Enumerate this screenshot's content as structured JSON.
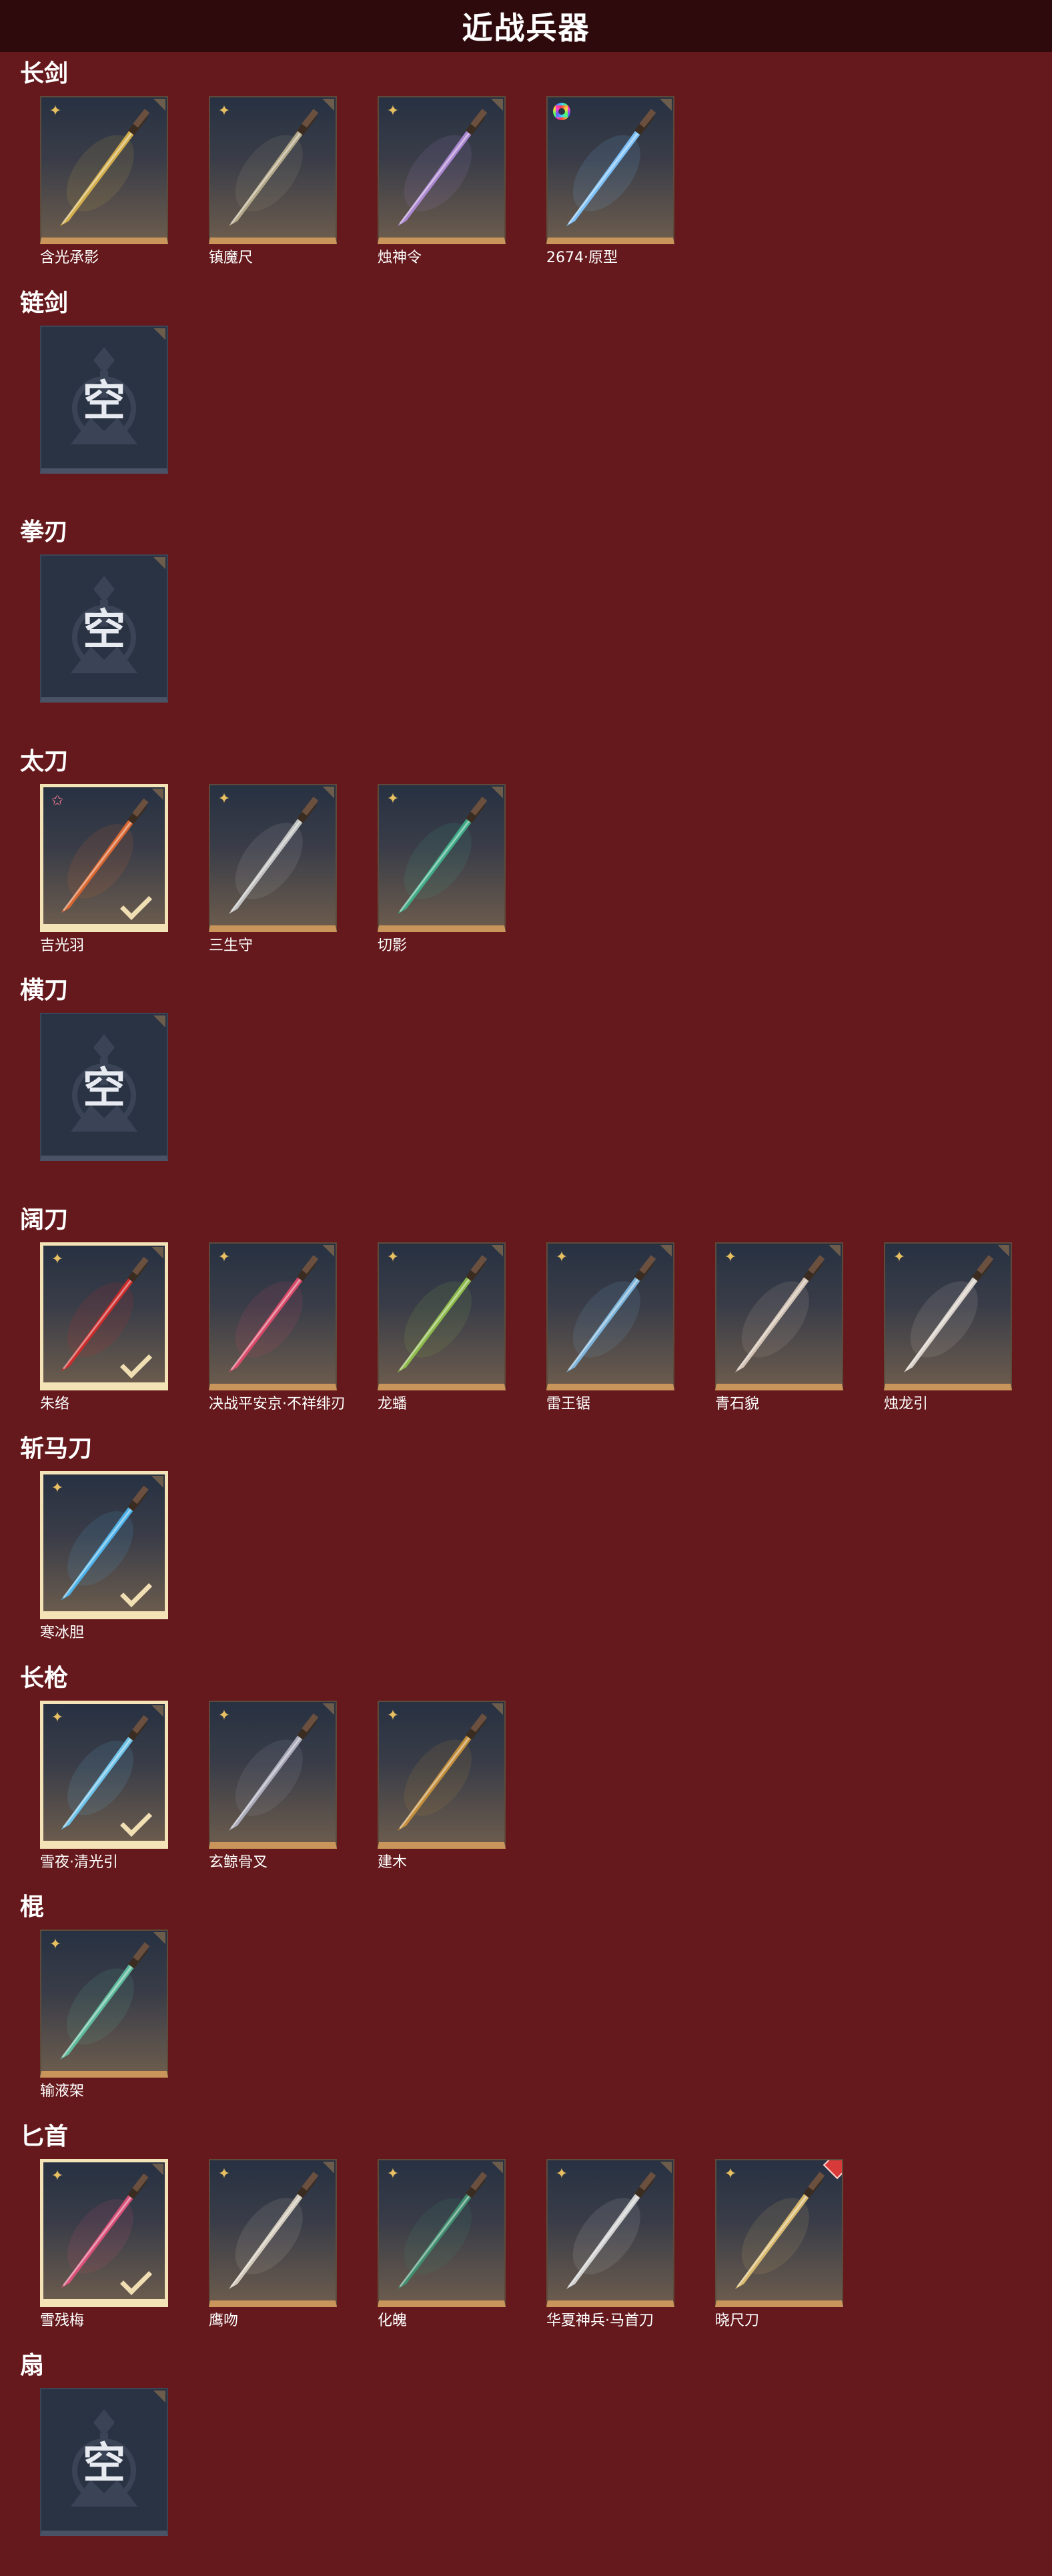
{
  "header": {
    "title": "近战兵器"
  },
  "colors": {
    "background": "#65191c",
    "header_bar": "#2e0a0d",
    "card_frame": "#c9955a",
    "selected_frame": "#f4e3b6",
    "rarity_gold": "#e8c061"
  },
  "categories": [
    {
      "title": "长剑",
      "items": [
        {
          "name": "含光承影",
          "rarity": "gold-star-icon",
          "selected": false,
          "blade": "#d9b24a"
        },
        {
          "name": "镇魔尺",
          "rarity": "gold-star-icon",
          "selected": false,
          "blade": "#b9ad8c"
        },
        {
          "name": "烛神令",
          "rarity": "gold-star-icon",
          "selected": false,
          "blade": "#b08ad8"
        },
        {
          "name": "2674·原型",
          "rarity": "rainbow-ring-icon",
          "selected": false,
          "blade": "#7fc6ff"
        }
      ]
    },
    {
      "title": "链剑",
      "empty_label": "空",
      "items": []
    },
    {
      "title": "拳刃",
      "empty_label": "空",
      "items": []
    },
    {
      "title": "太刀",
      "items": [
        {
          "name": "吉光羽",
          "rarity": "pink-star-icon",
          "selected": true,
          "blade": "#e0682f"
        },
        {
          "name": "三生守",
          "rarity": "gold-star-icon",
          "selected": false,
          "blade": "#c8c8c8"
        },
        {
          "name": "切影",
          "rarity": "gold-star-icon",
          "selected": false,
          "blade": "#3fb08a"
        }
      ]
    },
    {
      "title": "横刀",
      "empty_label": "空",
      "items": []
    },
    {
      "title": "阔刀",
      "items": [
        {
          "name": "朱络",
          "rarity": "gold-star-icon",
          "selected": true,
          "blade": "#d42a2a"
        },
        {
          "name": "决战平安京·不祥绯刃",
          "rarity": "gold-star-icon",
          "selected": false,
          "blade": "#e04a6a"
        },
        {
          "name": "龙蟠",
          "rarity": "gold-star-icon",
          "selected": false,
          "blade": "#8fc04a"
        },
        {
          "name": "雷王锯",
          "rarity": "gold-star-icon",
          "selected": false,
          "blade": "#7fb8e0"
        },
        {
          "name": "青石貌",
          "rarity": "gold-star-icon",
          "selected": false,
          "blade": "#d8c8b8"
        },
        {
          "name": "烛龙引",
          "rarity": "gold-star-icon",
          "selected": false,
          "blade": "#e0d8d0"
        }
      ]
    },
    {
      "title": "斩马刀",
      "items": [
        {
          "name": "寒冰胆",
          "rarity": "gold-star-icon",
          "selected": true,
          "blade": "#4fb8f0"
        }
      ]
    },
    {
      "title": "长枪",
      "items": [
        {
          "name": "雪夜·清光引",
          "rarity": "gold-star-icon",
          "selected": true,
          "blade": "#6fc8f0"
        },
        {
          "name": "玄鲸骨叉",
          "rarity": "gold-star-icon",
          "selected": false,
          "blade": "#b0b0c0"
        },
        {
          "name": "建木",
          "rarity": "gold-star-icon",
          "selected": false,
          "blade": "#c8903a"
        }
      ]
    },
    {
      "title": "棍",
      "items": [
        {
          "name": "输液架",
          "rarity": "gold-star-icon",
          "selected": false,
          "blade": "#5fc0a0"
        }
      ]
    },
    {
      "title": "匕首",
      "items": [
        {
          "name": "雪残梅",
          "rarity": "gold-star-icon",
          "selected": true,
          "blade": "#e0507a"
        },
        {
          "name": "鹰吻",
          "rarity": "gold-star-icon",
          "selected": false,
          "blade": "#d8d0c0"
        },
        {
          "name": "化魄",
          "rarity": "gold-star-icon",
          "selected": false,
          "blade": "#3f9070"
        },
        {
          "name": "华夏神兵·马首刀",
          "rarity": "gold-star-icon",
          "selected": false,
          "blade": "#d8d8d8"
        },
        {
          "name": "晓尺刀",
          "rarity": "gold-star-icon",
          "selected": false,
          "blade": "#e0c070",
          "badge": "red-diamond-icon"
        }
      ]
    },
    {
      "title": "扇",
      "empty_label": "空",
      "items": []
    }
  ]
}
